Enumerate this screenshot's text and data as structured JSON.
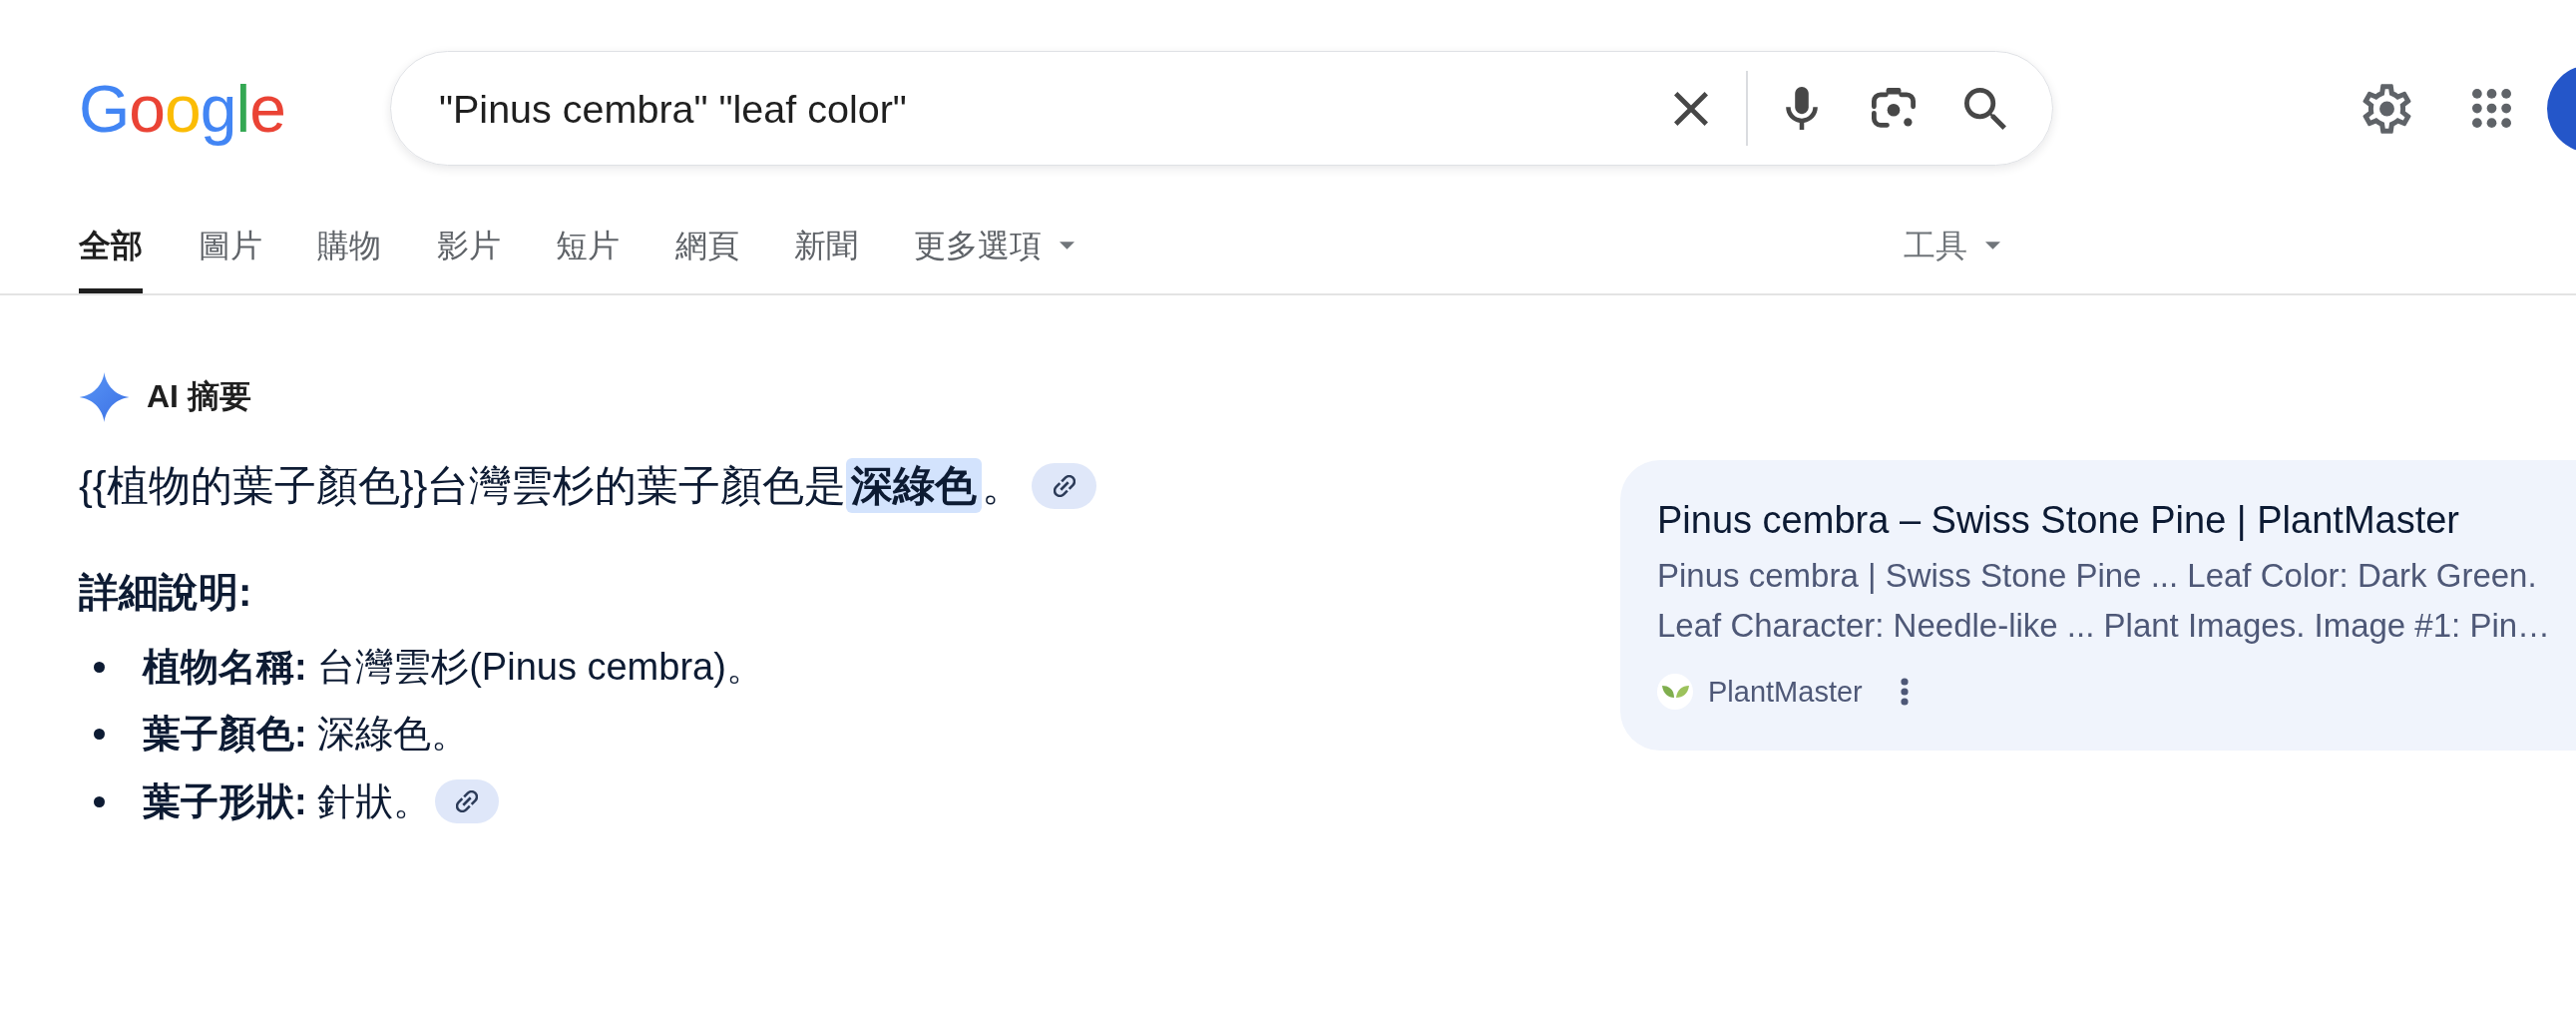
{
  "header": {
    "logo": "Google",
    "search": {
      "value": "\"Pinus cembra\" \"leaf color\""
    }
  },
  "tabs": [
    {
      "label": "全部",
      "selected": true,
      "kind": "tab"
    },
    {
      "label": "圖片",
      "selected": false,
      "kind": "tab"
    },
    {
      "label": "購物",
      "selected": false,
      "kind": "tab"
    },
    {
      "label": "影片",
      "selected": false,
      "kind": "tab"
    },
    {
      "label": "短片",
      "selected": false,
      "kind": "tab"
    },
    {
      "label": "網頁",
      "selected": false,
      "kind": "tab"
    },
    {
      "label": "新聞",
      "selected": false,
      "kind": "tab"
    },
    {
      "label": "更多選項",
      "selected": false,
      "kind": "menu"
    }
  ],
  "tools": {
    "label": "工具"
  },
  "ai_overview": {
    "title": "AI 摘要",
    "answer": {
      "text": "{{植物的葉子顏色}}台灣雲杉的葉子顏色是**深綠色**。",
      "link": true
    },
    "heading": "詳細說明:",
    "bullets": [
      {
        "text": "**植物名稱:** 台灣雲杉(Pinus cembra)。",
        "link": false
      },
      {
        "text": "**葉子顏色:** 深綠色。",
        "link": false
      },
      {
        "text": "**葉子形狀:** 針狀。",
        "link": true
      }
    ]
  },
  "source_card": {
    "title": "Pinus cembra – Swiss Stone Pine | PlantMaster",
    "snippet_lines": [
      "Pinus cembra | Swiss Stone Pine ... Leaf Color: Dark Green.",
      "Leaf Character: Needle-like ... Plant Images. Image #1: Pin…"
    ],
    "site": "PlantMaster"
  }
}
